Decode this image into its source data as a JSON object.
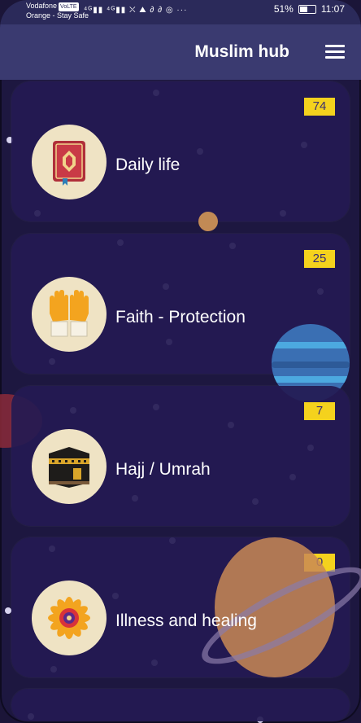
{
  "statusbar": {
    "carrier_line1": "Vodafone",
    "volte": "VoLTE",
    "carrier_line2": "Orange - Stay Safe",
    "icons_text": "⁴ᴳ▮▮ ⁴ᴳ▮▮ ⛌ ⛰ ∂ ∂ ◎ ···",
    "battery_percent": "51%",
    "time": "11:07",
    "battery_level": 0.51
  },
  "header": {
    "title": "Muslim hub"
  },
  "categories": [
    {
      "label": "Daily life",
      "count": "74",
      "icon": "quran-book-icon"
    },
    {
      "label": "Faith - Protection",
      "count": "25",
      "icon": "praying-hands-icon"
    },
    {
      "label": "Hajj / Umrah",
      "count": "7",
      "icon": "kaaba-icon"
    },
    {
      "label": "Illness and healing",
      "count": "0",
      "icon": "rosette-icon"
    }
  ],
  "colors": {
    "background": "#1d1740",
    "card": "#241a52",
    "header": "#3a3a70",
    "badge": "#f4d21d"
  }
}
